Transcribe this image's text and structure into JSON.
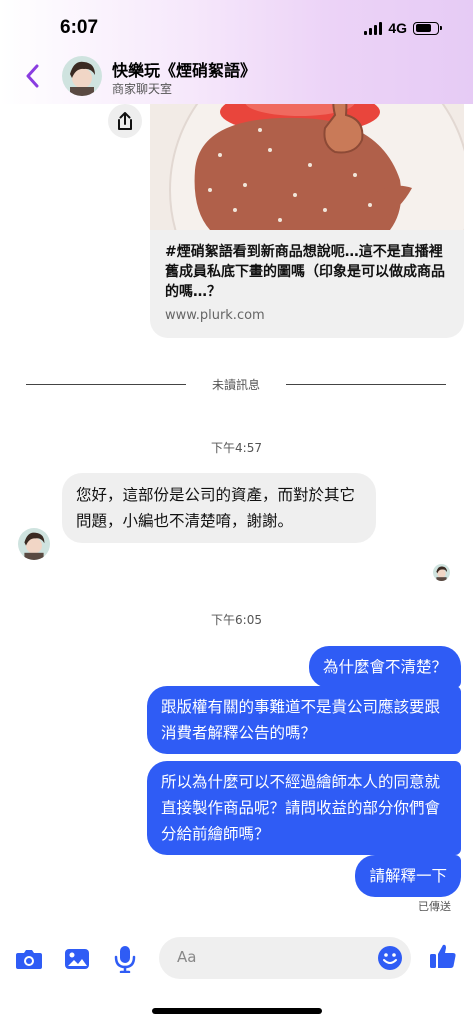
{
  "status": {
    "time": "6:07",
    "network": "4G",
    "battery_level": 0.75
  },
  "header": {
    "title": "快樂玩《煙硝絮語》",
    "subtitle": "商家聊天室"
  },
  "link_preview": {
    "title": "#煙硝絮語看到新商品想說呃…這不是直播裡舊成員私底下畫的圖嗎（印象是可以做成商品的嗎…？",
    "domain": "www.plurk.com"
  },
  "unread_label": "未讀訊息",
  "timestamps": [
    "下午4:57",
    "下午6:05"
  ],
  "incoming_message": "您好，這部份是公司的資產，而對於其它問題，小編也不清楚唷，謝謝。",
  "outgoing_messages": [
    "為什麼會不清楚？",
    "跟版權有關的事難道不是貴公司應該要跟消費者解釋公告的嗎？",
    "所以為什麼可以不經過繪師本人的同意就直接製作商品呢？請問收益的部分你們會分給前繪師嗎？",
    "請解釋一下"
  ],
  "sent_status": "已傳送",
  "composer": {
    "placeholder": "Aa"
  },
  "colors": {
    "accent": "#2f5cf5",
    "header_gradient": "#e6cbf5",
    "back_arrow": "#8a3ce0"
  },
  "icons": [
    "back-arrow-icon",
    "share-icon",
    "camera-icon",
    "photo-icon",
    "microphone-icon",
    "emoji-icon",
    "thumbs-up-icon"
  ]
}
